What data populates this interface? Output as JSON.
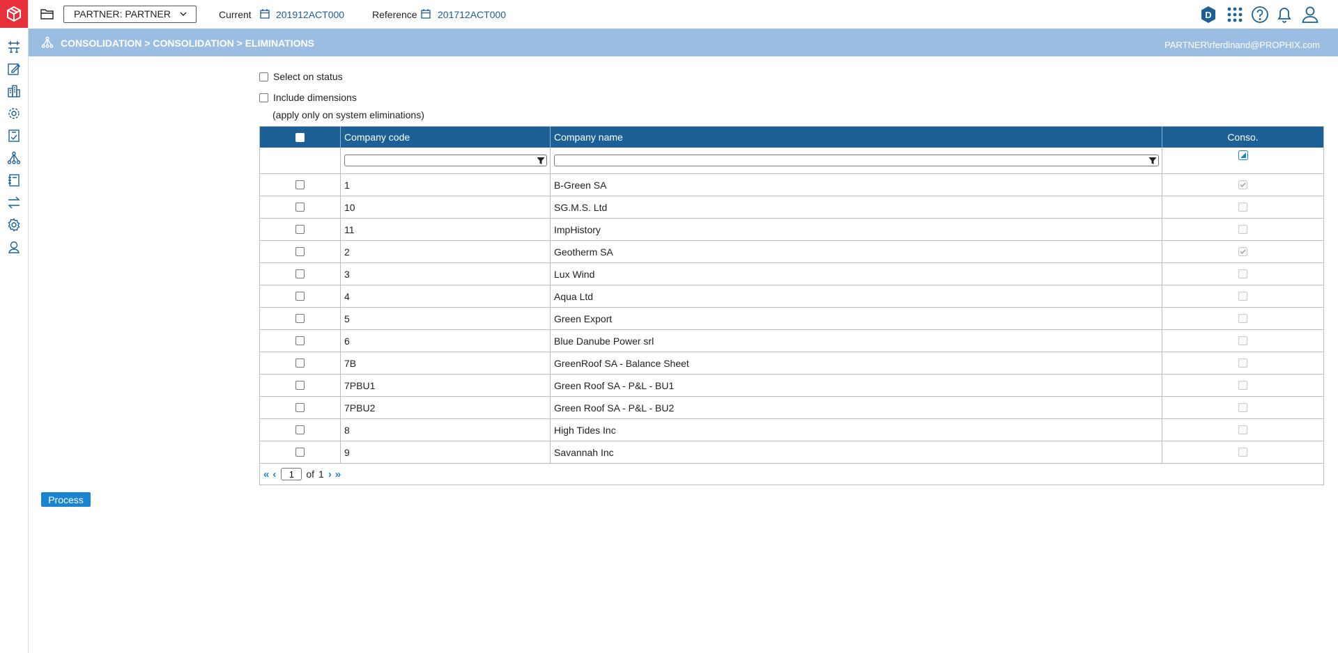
{
  "topbar": {
    "partner_select": "PARTNER: PARTNER",
    "current_label": "Current",
    "current_period": "201912ACT000",
    "reference_label": "Reference",
    "reference_period": "201712ACT000",
    "badge_letter": "D"
  },
  "header": {
    "breadcrumb": "CONSOLIDATION > CONSOLIDATION > ELIMINATIONS",
    "user": "PARTNER\\rferdinand@PROPHIX.com"
  },
  "options": {
    "select_on_status": "Select on status",
    "include_dimensions": "Include dimensions",
    "note": "(apply only on system eliminations)"
  },
  "table": {
    "columns": [
      "Company code",
      "Company name",
      "Conso."
    ],
    "rows": [
      {
        "code": "1",
        "name": "B-Green SA",
        "conso": true
      },
      {
        "code": "10",
        "name": "SG.M.S. Ltd",
        "conso": false
      },
      {
        "code": "11",
        "name": "ImpHistory",
        "conso": false
      },
      {
        "code": "2",
        "name": "Geotherm SA",
        "conso": true
      },
      {
        "code": "3",
        "name": "Lux Wind",
        "conso": false
      },
      {
        "code": "4",
        "name": "Aqua Ltd",
        "conso": false
      },
      {
        "code": "5",
        "name": "Green Export",
        "conso": false
      },
      {
        "code": "6",
        "name": "Blue Danube Power srl",
        "conso": false
      },
      {
        "code": "7B",
        "name": "GreenRoof SA - Balance Sheet",
        "conso": false
      },
      {
        "code": "7PBU1",
        "name": "Green Roof SA - P&L - BU1",
        "conso": false
      },
      {
        "code": "7PBU2",
        "name": "Green Roof SA - P&L - BU2",
        "conso": false
      },
      {
        "code": "8",
        "name": "High Tides Inc",
        "conso": false
      },
      {
        "code": "9",
        "name": "Savannah Inc",
        "conso": false
      }
    ]
  },
  "pager": {
    "page": "1",
    "of_label": "of",
    "total": "1"
  },
  "process_label": "Process",
  "colors": {
    "brand": "#e8303a",
    "header_band": "#9cbde2",
    "table_header": "#1c6095",
    "link": "#1a5d96",
    "button": "#1a84d0"
  }
}
